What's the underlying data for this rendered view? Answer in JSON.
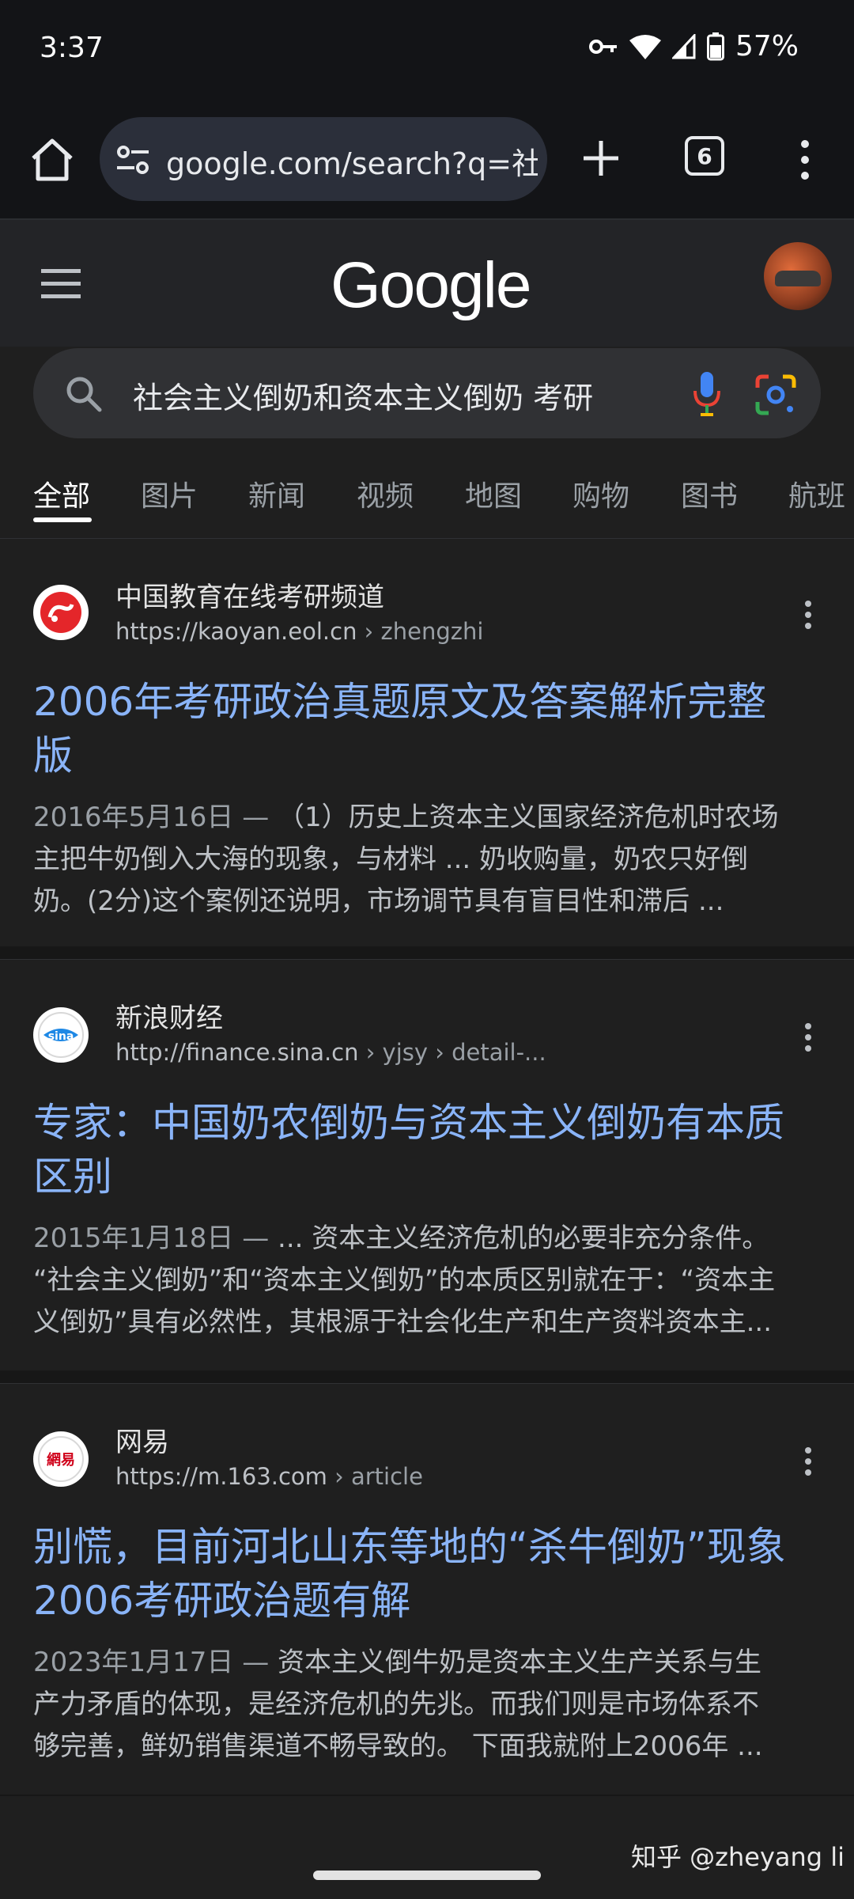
{
  "status_bar": {
    "time": "3:37",
    "battery": "57%"
  },
  "browser": {
    "url": "google.com/search?q=社",
    "tab_count": "6"
  },
  "google": {
    "logo": "Google"
  },
  "search": {
    "query": "社会主义倒奶和资本主义倒奶 考研"
  },
  "tabs": [
    {
      "label": "全部",
      "active": true
    },
    {
      "label": "图片"
    },
    {
      "label": "新闻"
    },
    {
      "label": "视频"
    },
    {
      "label": "地图"
    },
    {
      "label": "购物"
    },
    {
      "label": "图书"
    },
    {
      "label": "航班"
    }
  ],
  "results": [
    {
      "site": "中国教育在线考研频道",
      "url_base": "https://kaoyan.eol.cn",
      "url_path": " › zhengzhi",
      "title_line1": "2006年考研政治真题原文及答案解析完整",
      "title_line2": "版",
      "date": "2016年5月16日 — ",
      "snippet_line1": "（1）历史上资本主义国家经济危机时农场",
      "snippet_line2": "主把牛奶倒入大海的现象，与材料 ... 奶收购量，奶农只好倒",
      "snippet_line3": "奶。(2分)这个案例还说明，市场调节具有盲目性和滞后 ..."
    },
    {
      "site": "新浪财经",
      "url_base": "http://finance.sina.cn",
      "url_path": " › yjsy › detail-...",
      "title_line1": "专家：中国奶农倒奶与资本主义倒奶有本质",
      "title_line2": "区别",
      "date": "2015年1月18日 — ",
      "snippet_line1": "... 资本主义经济危机的必要非充分条件。",
      "snippet_line2": "“社会主义倒奶”和“资本主义倒奶”的本质区别就在于：“资本主",
      "snippet_line3": "义倒奶”具有必然性，其根源于社会化生产和生产资料资本主..."
    },
    {
      "site": "网易",
      "url_base": "https://m.163.com",
      "url_path": " › article",
      "title_line1": "别慌，目前河北山东等地的“杀牛倒奶”现象",
      "title_line2": "2006考研政治题有解",
      "date": "2023年1月17日 — ",
      "snippet_line1": "资本主义倒牛奶是资本主义生产关系与生",
      "snippet_line2": "产力矛盾的体现，是经济危机的先兆。而我们则是市场体系不",
      "snippet_line3": "够完善，鲜奶销售渠道不畅导致的。 下面我就附上2006年 ..."
    }
  ],
  "favicons": {
    "eol": "eol-logo-icon",
    "sina": "sina-logo-icon",
    "netease": "netease-logo-icon",
    "netease_text": "網易"
  },
  "watermark": "知乎 @zheyang li",
  "colors": {
    "link": "#8ab4f8",
    "background": "#1f1f1f",
    "search_bg": "#303134"
  }
}
